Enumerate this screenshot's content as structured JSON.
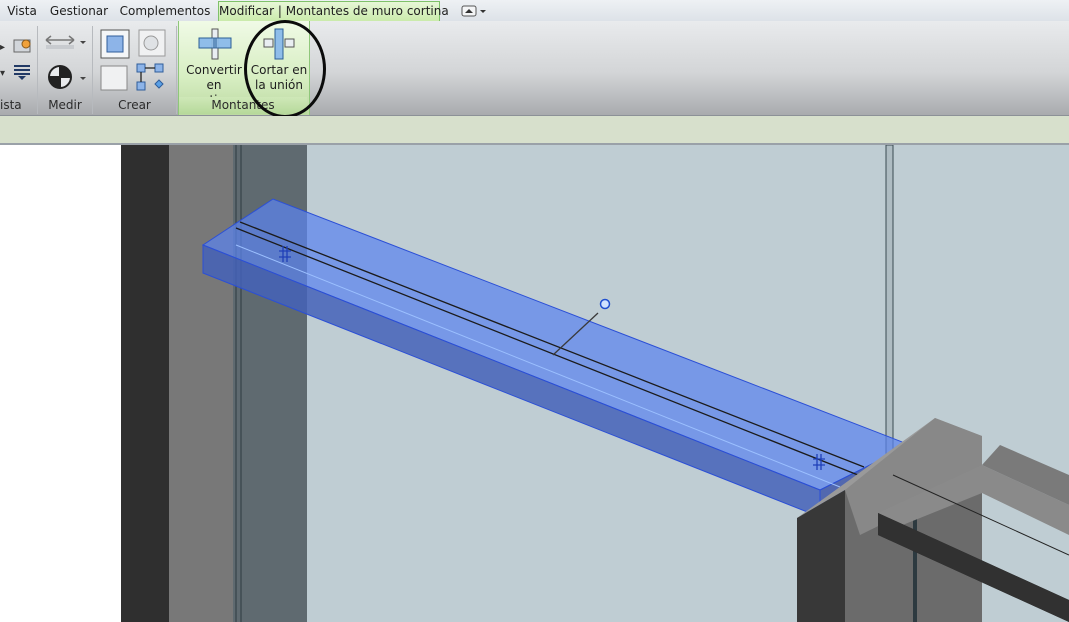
{
  "tabs": [
    {
      "label": "Vista"
    },
    {
      "label": "Gestionar"
    },
    {
      "label": "Complementos"
    },
    {
      "label": "Modificar | Montantes de muro cortina"
    }
  ],
  "panels": {
    "vista": "ista",
    "medir": "Medir",
    "crear": "Crear",
    "montantes": "Montantes"
  },
  "buttons": {
    "convertir": {
      "line1": "Convertir en",
      "line2": "continuo"
    },
    "cortar": {
      "line1": "Cortar en",
      "line2": "la unión"
    }
  },
  "icons": {
    "qat": "window-toggle-icon",
    "convertir": "mullion-continuous-icon",
    "cortar": "mullion-break-icon"
  },
  "colors": {
    "selection": "#4d79f0",
    "context_tab": "#c9eaa9",
    "glass": "#bfcdd3"
  }
}
